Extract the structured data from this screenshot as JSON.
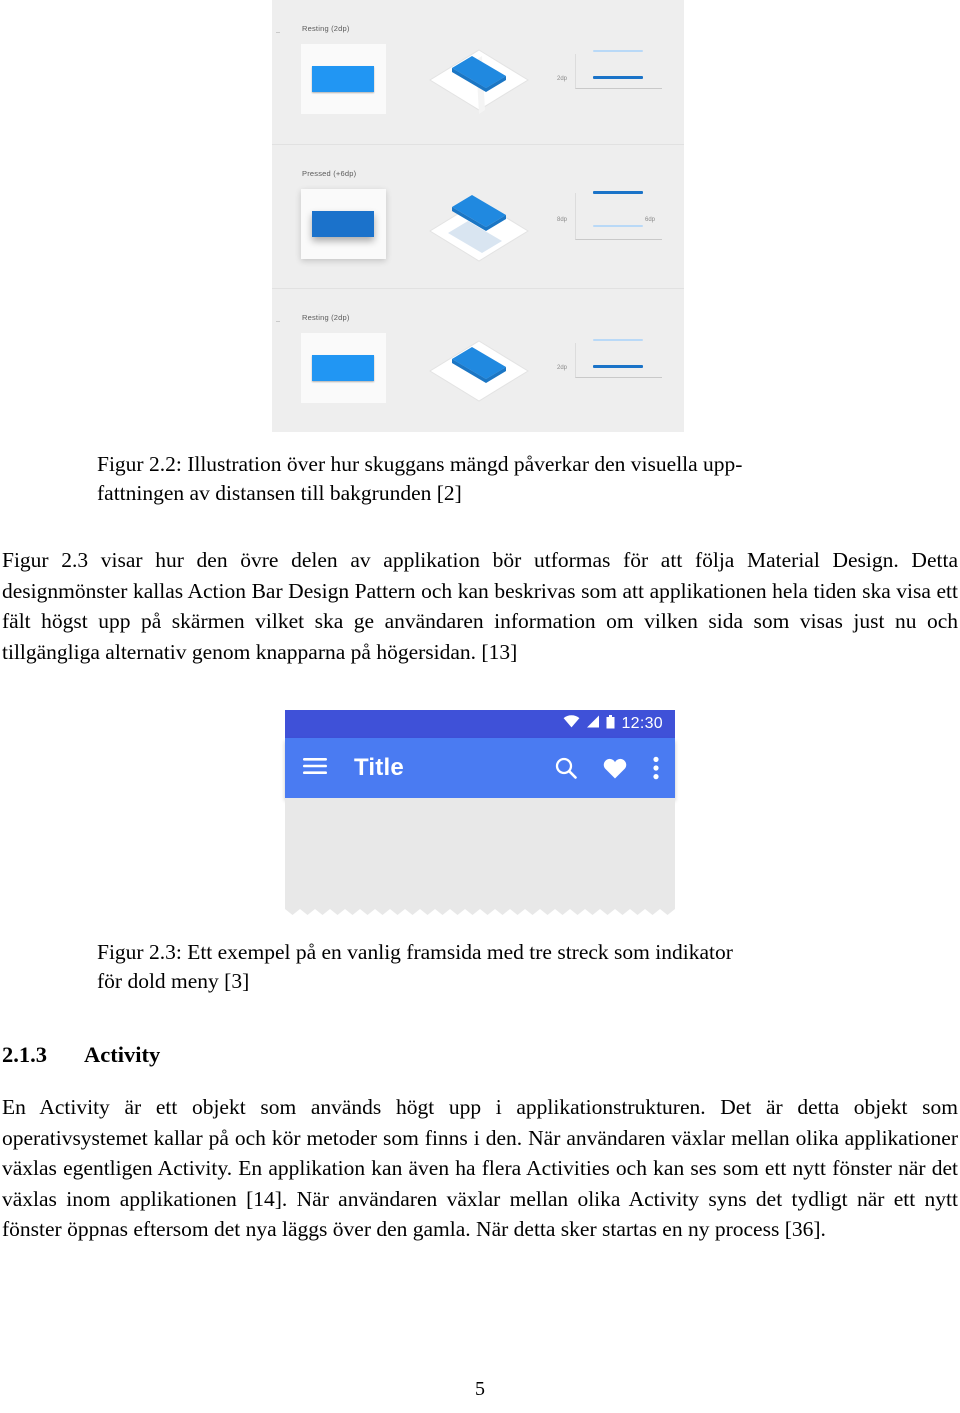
{
  "figure_22": {
    "name": "material-shadow-illustration",
    "background_color": "#eeeeee",
    "accent_blue_rest": "#2196f3",
    "accent_blue_pressed": "#1b72cb",
    "rows": [
      {
        "label": "Resting (2dp)",
        "state": "resting",
        "scale_label_left": "2dp",
        "scale_label_right": ""
      },
      {
        "label": "Pressed (+6dp)",
        "state": "pressed",
        "scale_label_left": "8dp",
        "scale_label_right": "6dp"
      },
      {
        "label": "Resting (2dp)",
        "state": "resting",
        "scale_label_left": "2dp",
        "scale_label_right": ""
      }
    ]
  },
  "caption_22": {
    "line1": "Figur 2.2: Illustration över hur skuggans mängd påverkar den visuella upp-",
    "line2": "fattningen av distansen till bakgrunden [2]"
  },
  "paragraph_1": "Figur 2.3 visar hur den övre delen av applikation bör utformas för att följa Material Design. Detta designmönster kallas Action Bar Design Pattern och kan beskrivas som att applikationen hela tiden ska visa ett fält högst upp på skärmen vilket ska ge användaren information om vilken sida som visas just nu och tillgängliga alternativ genom knapparna på högersidan. [13]",
  "figure_23": {
    "name": "android-action-bar-mockup",
    "status_bar": {
      "time": "12:30",
      "icons": [
        "wifi-icon",
        "signal-icon",
        "battery-icon"
      ],
      "background_color": "#3f51d8"
    },
    "app_bar": {
      "title": "Title",
      "background_color": "#4a7bf2",
      "nav_icon": "hamburger-menu-icon",
      "actions": [
        "search-icon",
        "heart-icon",
        "overflow-menu-icon"
      ]
    },
    "content_background_color": "#e8e8e8"
  },
  "caption_23": {
    "line1": "Figur 2.3: Ett exempel på en vanlig framsida med tre streck som indikator",
    "line2": "för dold meny [3]"
  },
  "section": {
    "number": "2.1.3",
    "title": "Activity"
  },
  "paragraph_2": "En Activity är ett objekt som används högt upp i applikationstrukturen. Det är detta objekt som operativsystemet kallar på och kör metoder som finns i den. När användaren växlar mellan olika applikationer växlas egentligen Activity. En applikation kan även ha flera Activities och kan ses som ett nytt fönster när det växlas inom applikationen [14]. När användaren växlar mellan olika Activity syns det tydligt när ett nytt fönster öppnas eftersom det nya läggs över den gamla. När detta sker startas en ny process  [36].",
  "page_number": "5"
}
